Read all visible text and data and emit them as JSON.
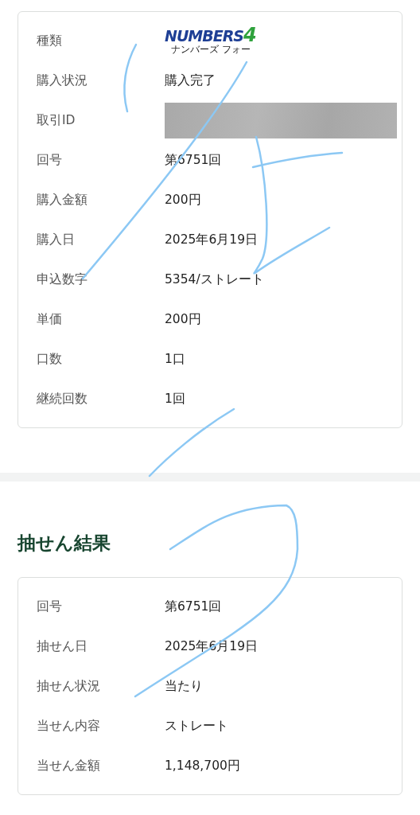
{
  "purchase": {
    "rows": [
      {
        "label": "種類",
        "kind": "logo",
        "logo": {
          "wordmark": "NUMBERS",
          "digit": "4",
          "reading": "ナンバーズ フォー"
        }
      },
      {
        "label": "購入状況",
        "kind": "text",
        "value": "購入完了"
      },
      {
        "label": "取引ID",
        "kind": "redacted"
      },
      {
        "label": "回号",
        "kind": "text",
        "value": "第6751回"
      },
      {
        "label": "購入金額",
        "kind": "text",
        "value": "200円"
      },
      {
        "label": "購入日",
        "kind": "text",
        "value": "2025年6月19日"
      },
      {
        "label": "申込数字",
        "kind": "text",
        "value": "5354/ストレート"
      },
      {
        "label": "単価",
        "kind": "text",
        "value": "200円"
      },
      {
        "label": "口数",
        "kind": "text",
        "value": "1口"
      },
      {
        "label": "継続回数",
        "kind": "text",
        "value": "1回"
      }
    ]
  },
  "result": {
    "title": "抽せん結果",
    "rows": [
      {
        "label": "回号",
        "kind": "text",
        "value": "第6751回"
      },
      {
        "label": "抽せん日",
        "kind": "text",
        "value": "2025年6月19日"
      },
      {
        "label": "抽せん状況",
        "kind": "text",
        "value": "当たり"
      },
      {
        "label": "当せん内容",
        "kind": "text",
        "value": "ストレート"
      },
      {
        "label": "当せん金額",
        "kind": "text",
        "value": "1,148,700円"
      }
    ]
  }
}
